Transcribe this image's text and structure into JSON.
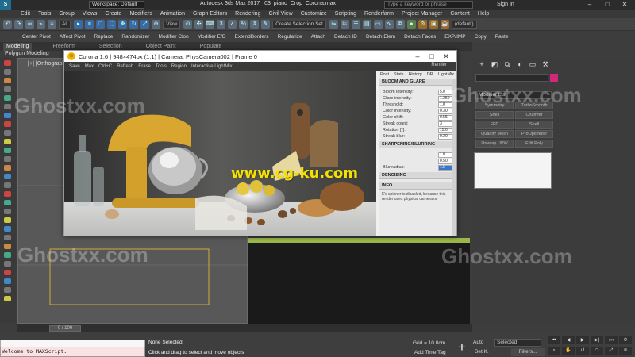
{
  "app": {
    "logo": "S",
    "workspace": "Workspace: Default",
    "title": "Autodesk 3ds Max 2017",
    "file": "03_piano_Crop_Corona.max",
    "search_placeholder": "Type a keyword or phrase",
    "sign_in": "Sign In"
  },
  "menu": [
    "Edit",
    "Tools",
    "Group",
    "Views",
    "Create",
    "Modifiers",
    "Animation",
    "Graph Editors",
    "Rendering",
    "Civil View",
    "Customize",
    "Scripting",
    "Renderfarm",
    "Project Manager",
    "Content",
    "Help"
  ],
  "toolbar": {
    "filter": "All",
    "view": "View",
    "selection_set": "Create Selection Set",
    "layer": "(default)"
  },
  "toolbar2": [
    "Center Pivot",
    "Affect Pivot",
    "Replace",
    "Randomizer",
    "Modifier Clon",
    "Modifier E/D",
    "ExtendBorders",
    "Regularize",
    "Attach",
    "Detach ID",
    "Detach Elem",
    "Detach Faces",
    "EXP/IMP",
    "Copy",
    "Paste"
  ],
  "ribbon": {
    "tabs": [
      "Modeling",
      "Freeform",
      "Selection",
      "Object Paint",
      "Populate"
    ],
    "active": "Modeling",
    "sub_label": "Polygon Modeling"
  },
  "viewport": {
    "left_label": "[+] [Orthographic]"
  },
  "vfb": {
    "title": "Corona 1.6 | 948×474px (1:1) | Camera: PhysCamera002 | Frame 0",
    "toolbar": [
      "Save",
      "Max",
      "Ctrl+C",
      "Refresh",
      "Erase",
      "Tools",
      "Region",
      "Interactive LightMix"
    ],
    "render_label": "Render",
    "panel_tabs": [
      "Post",
      "Stats",
      "History",
      "DR",
      "LightMix"
    ],
    "bloom_header": "BLOOM AND GLARE",
    "bloom_rows": [
      {
        "label": "Bloom intensity:",
        "value": "5.0"
      },
      {
        "label": "Glare intensity:",
        "value": "1.250"
      },
      {
        "label": "Threshold:",
        "value": "1.0"
      },
      {
        "label": "Color intensity:",
        "value": "0.30"
      },
      {
        "label": "Color shift:",
        "value": "0.55"
      },
      {
        "label": "Streak count:",
        "value": "3"
      },
      {
        "label": "Rotation [°]:",
        "value": "15.0"
      },
      {
        "label": "Streak blur:",
        "value": "0.20"
      }
    ],
    "sharpen_header": "SHARPENING/BLURRING",
    "sharpen_rows": [
      {
        "label": "",
        "value": "1.0"
      },
      {
        "label": "",
        "value": "0.50"
      },
      {
        "label": "Blur radius:",
        "value": "1.5"
      }
    ],
    "denoise_header": "DENOISING",
    "info_header": "INFO",
    "info_text": "EV spinner is disabled, because this render uses physical camera or"
  },
  "command_panel": {
    "modifier_list": "Modifier List",
    "buttons": [
      "Symmetry",
      "TurboSmooth",
      "Shell",
      "Chamfer",
      "FFD",
      "Shell",
      "Quadify Mesh",
      "ProOptimizer",
      "Unwrap UVW",
      "Edit Poly"
    ]
  },
  "timeline": {
    "frame": "0 / 100"
  },
  "status": {
    "maxscript": "Welcome to MAXScript.",
    "selection": "None Selected",
    "prompt": "Click and drag to select and move objects",
    "grid": "Grid = 10.0cm",
    "add_time_tag": "Add Time Tag",
    "auto": "Auto",
    "selected": "Selected",
    "set_k": "Set K.",
    "filters": "Filters..."
  },
  "watermarks": [
    "Ghostxx.com",
    "www.cg-ku.com"
  ],
  "colors": {
    "accent_yellow": "#f0c030",
    "mixer_yellow": "#d9a630",
    "viewport_green": "#9ab84a",
    "command_color": "#d0287a"
  }
}
